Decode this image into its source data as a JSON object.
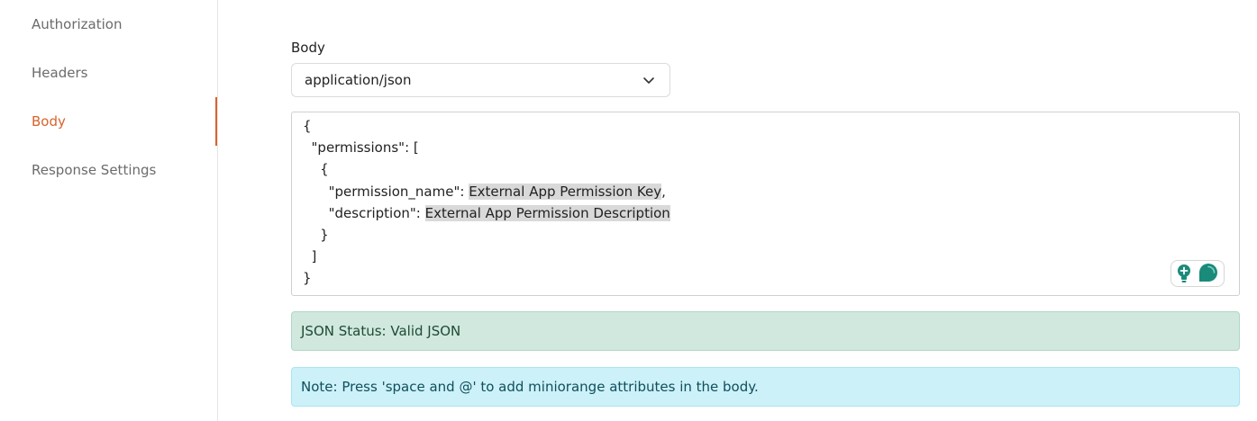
{
  "sidebar": {
    "items": [
      {
        "label": "Authorization",
        "active": false
      },
      {
        "label": "Headers",
        "active": false
      },
      {
        "label": "Body",
        "active": true
      },
      {
        "label": "Response Settings",
        "active": false
      }
    ],
    "active_color": "#d9622b"
  },
  "body_section": {
    "label": "Body",
    "content_type": {
      "value": "application/json",
      "icon": "chevron-down-icon"
    },
    "editor": {
      "lines": [
        {
          "prefix": "{",
          "highlight": "",
          "suffix": ""
        },
        {
          "prefix": "  \"permissions\": [",
          "highlight": "",
          "suffix": ""
        },
        {
          "prefix": "    {",
          "highlight": "",
          "suffix": ""
        },
        {
          "prefix": "      \"permission_name\": ",
          "highlight": "External App Permission Key",
          "suffix": ","
        },
        {
          "prefix": "      \"description\": ",
          "highlight": "External App Permission Description",
          "suffix": ""
        },
        {
          "prefix": "    }",
          "highlight": "",
          "suffix": ""
        },
        {
          "prefix": "  ]",
          "highlight": "",
          "suffix": ""
        },
        {
          "prefix": "}",
          "highlight": "",
          "suffix": ""
        }
      ],
      "assistant_icons": [
        "lightbulb-icon",
        "chat-bubble-icon"
      ]
    },
    "json_status": "JSON Status: Valid JSON",
    "note": "Note: Press 'space and @' to add miniorange attributes in the body."
  },
  "colors": {
    "success_bg": "#d0e8dd",
    "info_bg": "#cdf1f9",
    "assistant_teal": "#1a8a7a"
  }
}
